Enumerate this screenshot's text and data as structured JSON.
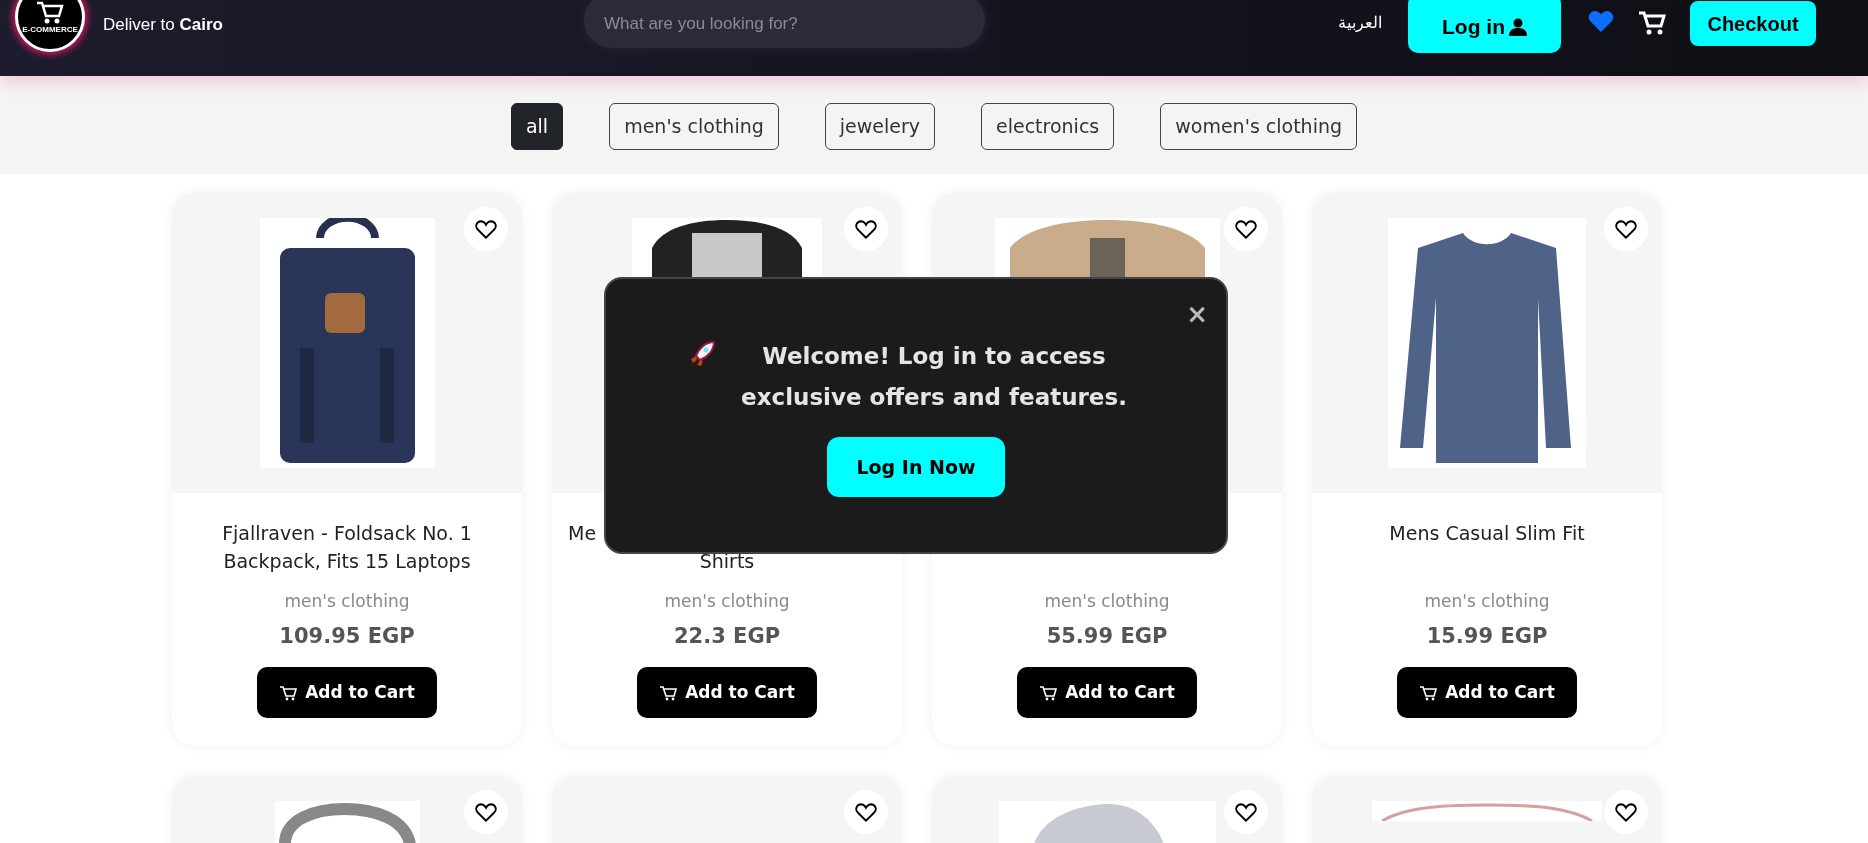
{
  "header": {
    "logo_text": "E-COMMERCE",
    "deliver": "Deliver to **Cairo**",
    "search": {
      "placeholder": "What are you looking for?"
    },
    "language": "العربية",
    "login": "Log in",
    "checkout": "Checkout"
  },
  "categories": [
    {
      "label": "all",
      "selected": true
    },
    {
      "label": "men's clothing",
      "selected": false
    },
    {
      "label": "jewelery",
      "selected": false
    },
    {
      "label": "electronics",
      "selected": false
    },
    {
      "label": "women's clothing",
      "selected": false
    }
  ],
  "products": [
    {
      "favorite": false,
      "title_lines": [
        "Fjallraven - Foldsack No. 1",
        "Backpack, Fits 15 Laptops"
      ],
      "category": "men's clothing",
      "price": "109.95 EGP",
      "button": "Add to Cart"
    },
    {
      "favorite": false,
      "title_lines": [
        "Me",
        "Shirts"
      ],
      "category": "men's clothing",
      "price": "22.3 EGP",
      "button": "Add to Cart"
    },
    {
      "favorite": false,
      "category": "men's clothing",
      "price": "55.99 EGP",
      "button": "Add to Cart"
    },
    {
      "favorite": false,
      "title_lines": [
        "Mens Casual Slim Fit"
      ],
      "category": "men's clothing",
      "price": "15.99 EGP",
      "button": "Add to Cart"
    },
    {
      "favorite": false
    },
    {
      "favorite": false
    },
    {
      "favorite": false
    },
    {
      "favorite": false
    }
  ],
  "popup": {
    "message": "Welcome! Log in to access exclusive offers and features.",
    "button": "Log In Now",
    "close": "×"
  }
}
